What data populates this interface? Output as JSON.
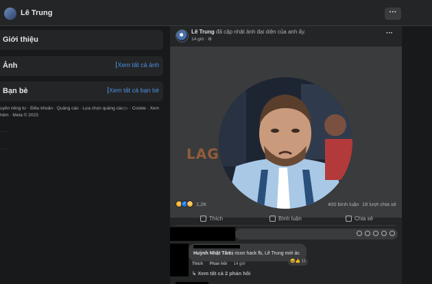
{
  "topbar": {
    "name": "Lê Trung",
    "more": "···"
  },
  "sidebar": {
    "intro_title": "Giới thiệu",
    "photos_title": "Ảnh",
    "photos_link": "Xem tất cả ảnh",
    "friends_title": "Bạn bè",
    "friends_link": "Xem tất cả bạn bè",
    "footer_links": "uyền riêng tư · Điều khoản · Quảng cáo · Lựa chọn quảng cáo ▷ · Cookie · Xem hêm · Meta © 2023"
  },
  "post": {
    "author": "Lê Trung",
    "action_text": " đã cập nhật ảnh đại diện của anh ấy.",
    "time": "14 giờ · ⚙",
    "more": "···",
    "watermark": "LAG",
    "reaction_count": "1,2K",
    "comments_count": "400 bình luận",
    "shares_count": "18 lượt chia sẻ",
    "like_label": "Thích",
    "comment_label": "Bình luận",
    "share_label": "Chia sẻ"
  },
  "comment": {
    "author": "Huỳnh Nhật Tân",
    "text": "bị ricon hack fb, Lê Trung mới ác",
    "like_action": "Thích",
    "reply_action": "Phản hồi",
    "time": "14 giờ",
    "reactions": "😆👍 11",
    "view_replies": "↳ Xem tất cả 2 phản hồi"
  }
}
